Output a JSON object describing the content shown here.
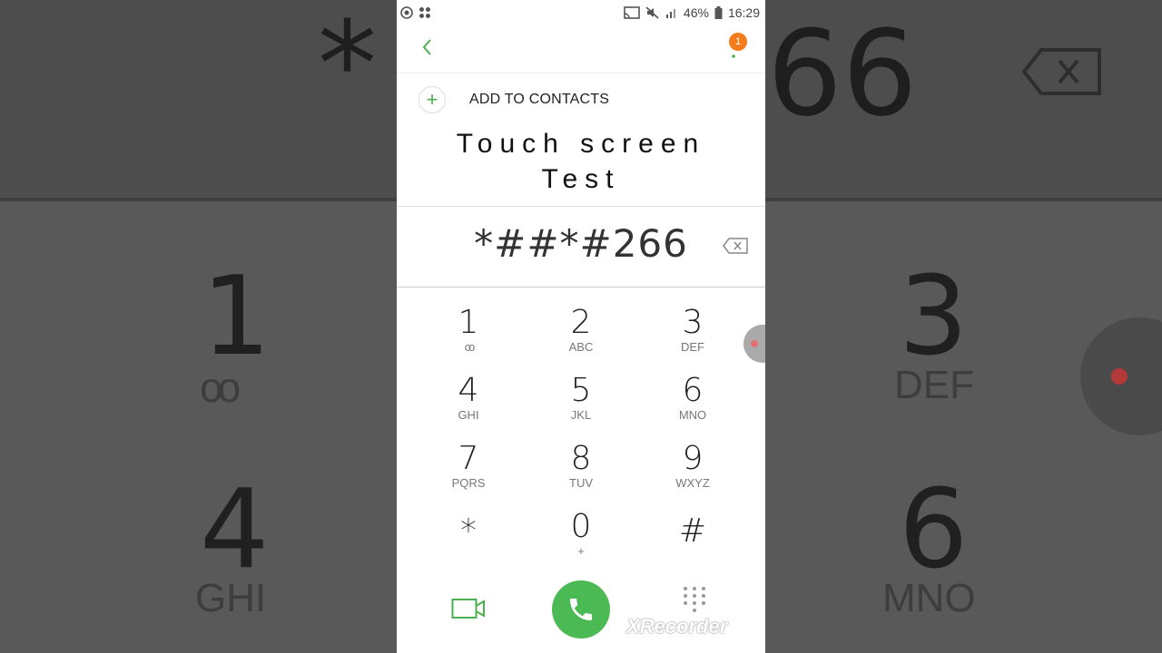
{
  "status_bar": {
    "battery": "46%",
    "time": "16:29"
  },
  "header": {
    "notification_count": "1"
  },
  "add_contacts": {
    "plus": "+",
    "label": "ADD TO CONTACTS"
  },
  "title": {
    "line1": "Touch screen",
    "line2": "Test"
  },
  "dial": {
    "number": "*##*#266"
  },
  "keypad": [
    {
      "digit": "1",
      "letters": "oo"
    },
    {
      "digit": "2",
      "letters": "ABC"
    },
    {
      "digit": "3",
      "letters": "DEF"
    },
    {
      "digit": "4",
      "letters": "GHI"
    },
    {
      "digit": "5",
      "letters": "JKL"
    },
    {
      "digit": "6",
      "letters": "MNO"
    },
    {
      "digit": "7",
      "letters": "PQRS"
    },
    {
      "digit": "8",
      "letters": "TUV"
    },
    {
      "digit": "9",
      "letters": "WXYZ"
    },
    {
      "digit": "*",
      "letters": ""
    },
    {
      "digit": "0",
      "letters": "+"
    },
    {
      "digit": "#",
      "letters": ""
    }
  ],
  "background": {
    "star": "*",
    "number_tail": "66",
    "one": "1",
    "three": "3",
    "three_letters": "DEF",
    "four": "4",
    "four_letters": "GHI",
    "six": "6",
    "six_letters": "MNO"
  },
  "watermark": "XRecorder",
  "colors": {
    "accent": "#4cba54",
    "badge": "#f47c1a"
  }
}
